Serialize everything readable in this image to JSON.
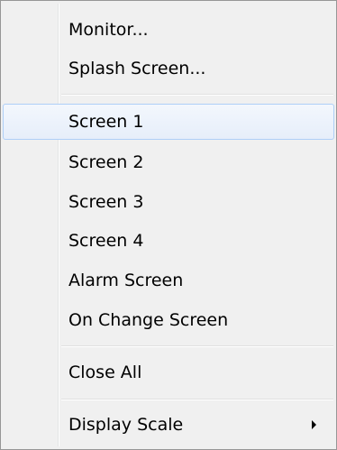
{
  "menu": {
    "items": [
      {
        "label": "Monitor..."
      },
      {
        "label": "Splash Screen..."
      },
      {
        "label": "Screen 1"
      },
      {
        "label": "Screen 2"
      },
      {
        "label": "Screen 3"
      },
      {
        "label": "Screen 4"
      },
      {
        "label": "Alarm Screen"
      },
      {
        "label": "On Change Screen"
      },
      {
        "label": "Close All"
      },
      {
        "label": "Display Scale"
      }
    ],
    "highlighted_item": "Screen 1",
    "submenu_icon": "chevron-right-icon"
  }
}
